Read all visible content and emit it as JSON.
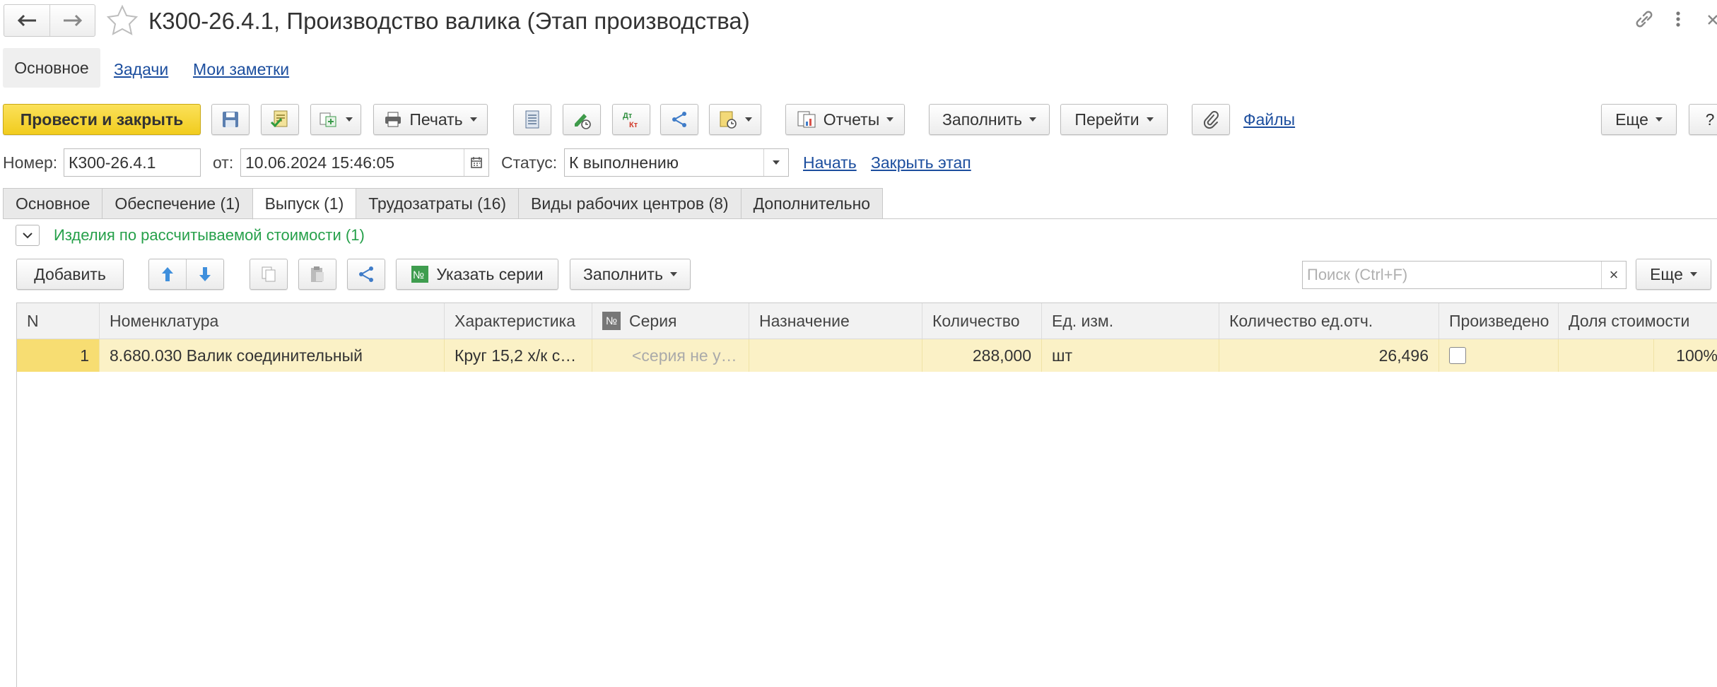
{
  "window": {
    "title": "К300-26.4.1, Производство валика (Этап производства)"
  },
  "sections": {
    "main": "Основное",
    "tasks": "Задачи",
    "notes": "Мои заметки"
  },
  "toolbar": {
    "post_close": "Провести и закрыть",
    "print": "Печать",
    "reports": "Отчеты",
    "fill": "Заполнить",
    "goto": "Перейти",
    "files": "Файлы",
    "more": "Еще",
    "help": "?"
  },
  "header": {
    "number_label": "Номер:",
    "number_value": "К300-26.4.1",
    "date_label": "от:",
    "date_value": "10.06.2024 15:46:05",
    "status_label": "Статус:",
    "status_value": "К выполнению",
    "start_link": "Начать",
    "close_stage_link": "Закрыть этап"
  },
  "tabs": [
    {
      "label": "Основное"
    },
    {
      "label": "Обеспечение (1)"
    },
    {
      "label": "Выпуск (1)"
    },
    {
      "label": "Трудозатраты (16)"
    },
    {
      "label": "Виды рабочих центров (8)"
    },
    {
      "label": "Дополнительно"
    }
  ],
  "group": {
    "title": "Изделия по рассчитываемой стоимости (1)"
  },
  "table_toolbar": {
    "add": "Добавить",
    "set_series": "Указать серии",
    "fill": "Заполнить",
    "search_placeholder": "Поиск (Ctrl+F)",
    "clear": "×",
    "more": "Еще"
  },
  "table": {
    "series_tag": "№",
    "columns": [
      "N",
      "Номенклатура",
      "Характеристика",
      "Серия",
      "Назначение",
      "Количество",
      "Ед. изм.",
      "Количество ед.отч.",
      "Произведено",
      "Доля стоимости"
    ],
    "rows": [
      {
        "n": "1",
        "item": "8.680.030 Валик соединительный",
        "characteristic": "Круг 15,2 х/к с…",
        "series": "<серия не у…",
        "purpose": "",
        "quantity": "288,000",
        "unit": "шт",
        "report_qty": "26,496",
        "produced": false,
        "cost_share": "100%"
      }
    ]
  },
  "colors": {
    "accent_yellow": "#f6d43a",
    "link_blue": "#1c4e9e",
    "group_green": "#26a04a",
    "row_selected": "#fbf1c6"
  }
}
